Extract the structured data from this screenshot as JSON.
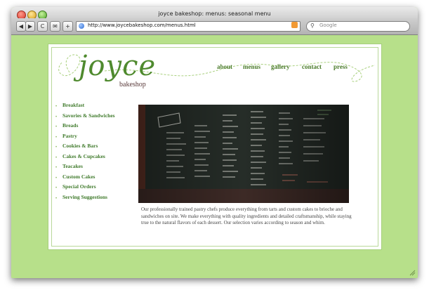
{
  "window": {
    "title": "joyce bakeshop: menus: seasonal menu"
  },
  "toolbar": {
    "back_label": "◀",
    "forward_label": "▶",
    "reload_label": "C",
    "snapback_label": "✉",
    "add_label": "+",
    "url": "http://www.joycebakeshop.com/menus.html",
    "search_placeholder": "Google"
  },
  "site": {
    "logo_name": "joyce",
    "logo_sub": "bakeshop",
    "nav": [
      {
        "label": "about"
      },
      {
        "label": "menus"
      },
      {
        "label": "gallery"
      },
      {
        "label": "contact"
      },
      {
        "label": "press"
      }
    ],
    "menu_items": [
      {
        "label": "Breakfast"
      },
      {
        "label": "Savories & Sandwiches"
      },
      {
        "label": "Breads"
      },
      {
        "label": "Pastry"
      },
      {
        "label": "Cookies & Bars"
      },
      {
        "label": "Cakes & Cupcakes"
      },
      {
        "label": "Teacakes"
      },
      {
        "label": "Custom Cakes"
      },
      {
        "label": "Special Orders"
      },
      {
        "label": "Serving Suggestions"
      }
    ],
    "description": "Our professionally trained pastry chefs produce everything from tarts and custom cakes to brioche and sandwiches on site. We make everything with quality ingredients and detailed craftsmanship, while staying true to the natural flavors of each dessert. Our selection varies according to season and whim."
  },
  "colors": {
    "background": "#b7e08a",
    "brand_green": "#4f8a2e",
    "nav_green": "#4a7b2a"
  },
  "icons": {
    "favicon": "globe-icon",
    "rss": "rss-icon",
    "search": "search-icon"
  }
}
